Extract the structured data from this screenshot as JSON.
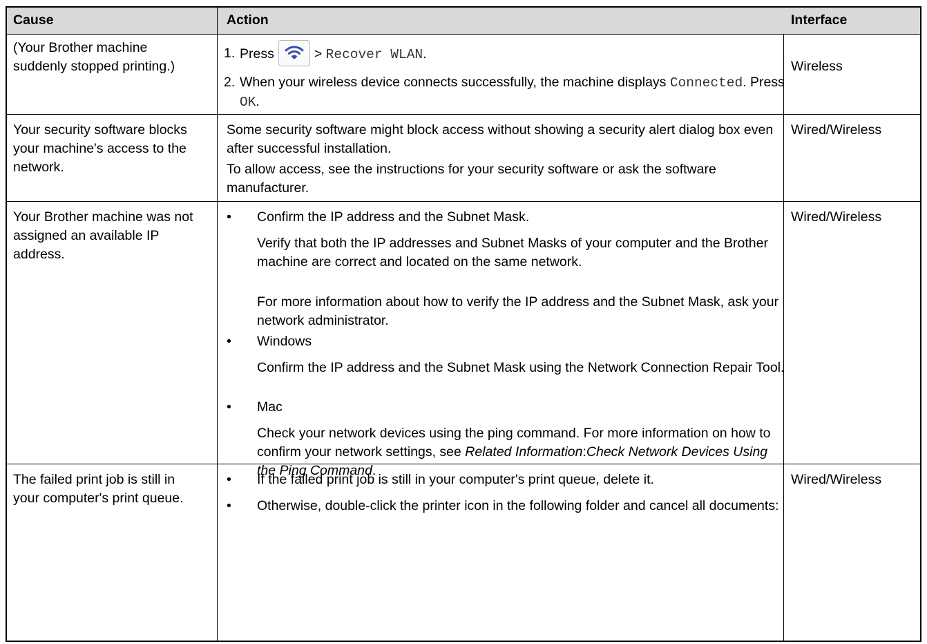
{
  "header": {
    "cause": "Cause",
    "action": "Action",
    "interface": "Interface"
  },
  "row1": {
    "cause": "(Your Brother machine suddenly stopped printing.)",
    "step1_num": "1.",
    "step1_press": "Press",
    "step1_arrow": ">",
    "step1_menu": "Recover WLAN",
    "step1_end": ".",
    "step2_num": "2.",
    "step2_text": "When your wireless device connects successfully, the machine displays",
    "step2_connected": "Connected",
    "step2_press": ". Press",
    "step2_ok": "OK",
    "step2_end": ".",
    "interface": "Wireless",
    "wifi_icon": "wifi-icon",
    "wifi_color": "#3a4ba8"
  },
  "row2": {
    "cause": "Your security software blocks your machine's access to the network.",
    "para1": "Some security software might block access without showing a security alert dialog box even after successful installation.",
    "para2": "To allow access, see the instructions for your security software or ask the software manufacturer.",
    "interface": "Wired/Wireless"
  },
  "row3": {
    "cause": "Your Brother machine was not assigned an available IP address.",
    "b1": "Confirm the IP address and the Subnet Mask.",
    "b1_p1": "Verify that both the IP addresses and Subnet Masks of your computer and the Brother machine are correct and located on the same network.",
    "b1_p2": "For more information about how to verify the IP address and the Subnet Mask, ask your network administrator.",
    "b2": "Windows",
    "b2_p1": "Confirm the IP address and the Subnet Mask using the Network Connection Repair Tool.",
    "b3": "Mac",
    "b3_p1": "Check your network devices using the ping command. For more information on how to confirm your network settings, see",
    "b3_rel": "Related Information",
    "b3_colon": ":",
    "b3_link": "Check Network Devices Using the Ping Command",
    "b3_end": ".",
    "interface": "Wired/Wireless"
  },
  "row4": {
    "cause": "The failed print job is still in your computer's print queue.",
    "b1": "If the failed print job is still in your computer's print queue, delete it.",
    "b2": "Otherwise, double-click the printer icon in the following folder and cancel all documents:",
    "interface": "Wired/Wireless"
  },
  "bullet": "•"
}
